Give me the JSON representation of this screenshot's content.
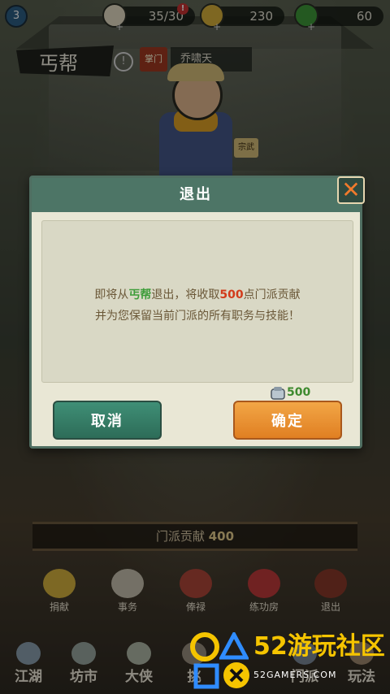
{
  "topbar": {
    "level": "3",
    "stamina": "35/30",
    "coins": "230",
    "jade": "60",
    "alert_mark": "!"
  },
  "sect": {
    "name": "丐帮",
    "info_mark": "!",
    "leader_tag": "掌门",
    "leader_name": "乔啸天",
    "npc_tag": "宗武"
  },
  "dialog": {
    "title": "退出",
    "close_glyph": "✕",
    "message_line1_prefix": "即将从",
    "message_sect": "丐帮",
    "message_line1_mid": "退出，将收取",
    "message_amount": "500",
    "message_line1_suffix": "点门派贡献",
    "message_line2": "并为您保留当前门派的所有职务与技能！",
    "cost_value": "500",
    "cancel_label": "取消",
    "confirm_label": "确定"
  },
  "contribution": {
    "label": "门派贡献",
    "value": "400"
  },
  "menu": [
    {
      "label": "捐献"
    },
    {
      "label": "事务"
    },
    {
      "label": "俸禄"
    },
    {
      "label": "练功房"
    },
    {
      "label": "退出"
    }
  ],
  "nav": [
    {
      "label": "江湖"
    },
    {
      "label": "坊市"
    },
    {
      "label": "大侠"
    },
    {
      "label": "挑"
    },
    {
      "label": "门派"
    },
    {
      "label": "玩法"
    }
  ],
  "watermark": {
    "text": "52游玩社区",
    "sub": "52GAMERS.COM"
  },
  "colors": {
    "dialog_header": "#4d7566",
    "cancel": "#3f8f76",
    "confirm": "#e07f22",
    "sect_highlight": "#3e9d3a",
    "amount_highlight": "#d23b1b"
  }
}
